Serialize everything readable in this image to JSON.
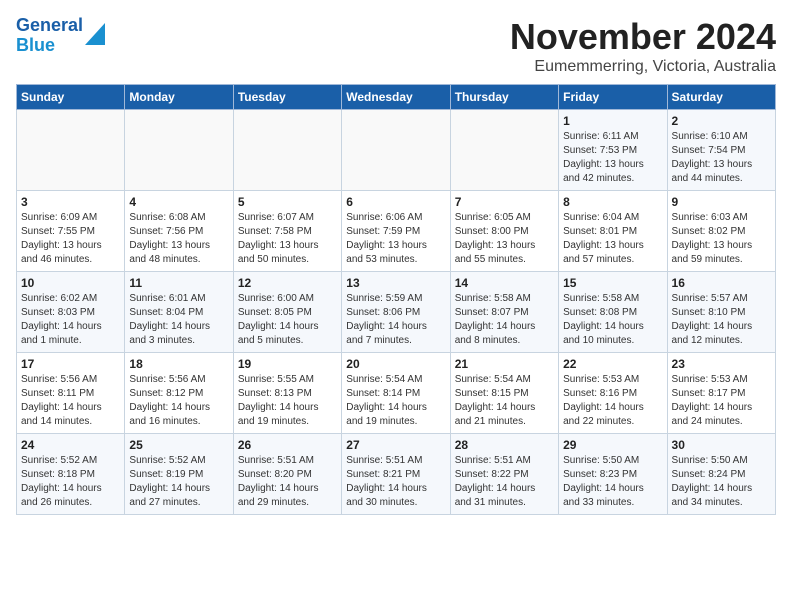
{
  "header": {
    "logo_line1": "General",
    "logo_line2": "Blue",
    "month": "November 2024",
    "location": "Eumemmerring, Victoria, Australia"
  },
  "weekdays": [
    "Sunday",
    "Monday",
    "Tuesday",
    "Wednesday",
    "Thursday",
    "Friday",
    "Saturday"
  ],
  "weeks": [
    [
      {
        "day": "",
        "info": ""
      },
      {
        "day": "",
        "info": ""
      },
      {
        "day": "",
        "info": ""
      },
      {
        "day": "",
        "info": ""
      },
      {
        "day": "",
        "info": ""
      },
      {
        "day": "1",
        "info": "Sunrise: 6:11 AM\nSunset: 7:53 PM\nDaylight: 13 hours\nand 42 minutes."
      },
      {
        "day": "2",
        "info": "Sunrise: 6:10 AM\nSunset: 7:54 PM\nDaylight: 13 hours\nand 44 minutes."
      }
    ],
    [
      {
        "day": "3",
        "info": "Sunrise: 6:09 AM\nSunset: 7:55 PM\nDaylight: 13 hours\nand 46 minutes."
      },
      {
        "day": "4",
        "info": "Sunrise: 6:08 AM\nSunset: 7:56 PM\nDaylight: 13 hours\nand 48 minutes."
      },
      {
        "day": "5",
        "info": "Sunrise: 6:07 AM\nSunset: 7:58 PM\nDaylight: 13 hours\nand 50 minutes."
      },
      {
        "day": "6",
        "info": "Sunrise: 6:06 AM\nSunset: 7:59 PM\nDaylight: 13 hours\nand 53 minutes."
      },
      {
        "day": "7",
        "info": "Sunrise: 6:05 AM\nSunset: 8:00 PM\nDaylight: 13 hours\nand 55 minutes."
      },
      {
        "day": "8",
        "info": "Sunrise: 6:04 AM\nSunset: 8:01 PM\nDaylight: 13 hours\nand 57 minutes."
      },
      {
        "day": "9",
        "info": "Sunrise: 6:03 AM\nSunset: 8:02 PM\nDaylight: 13 hours\nand 59 minutes."
      }
    ],
    [
      {
        "day": "10",
        "info": "Sunrise: 6:02 AM\nSunset: 8:03 PM\nDaylight: 14 hours\nand 1 minute."
      },
      {
        "day": "11",
        "info": "Sunrise: 6:01 AM\nSunset: 8:04 PM\nDaylight: 14 hours\nand 3 minutes."
      },
      {
        "day": "12",
        "info": "Sunrise: 6:00 AM\nSunset: 8:05 PM\nDaylight: 14 hours\nand 5 minutes."
      },
      {
        "day": "13",
        "info": "Sunrise: 5:59 AM\nSunset: 8:06 PM\nDaylight: 14 hours\nand 7 minutes."
      },
      {
        "day": "14",
        "info": "Sunrise: 5:58 AM\nSunset: 8:07 PM\nDaylight: 14 hours\nand 8 minutes."
      },
      {
        "day": "15",
        "info": "Sunrise: 5:58 AM\nSunset: 8:08 PM\nDaylight: 14 hours\nand 10 minutes."
      },
      {
        "day": "16",
        "info": "Sunrise: 5:57 AM\nSunset: 8:10 PM\nDaylight: 14 hours\nand 12 minutes."
      }
    ],
    [
      {
        "day": "17",
        "info": "Sunrise: 5:56 AM\nSunset: 8:11 PM\nDaylight: 14 hours\nand 14 minutes."
      },
      {
        "day": "18",
        "info": "Sunrise: 5:56 AM\nSunset: 8:12 PM\nDaylight: 14 hours\nand 16 minutes."
      },
      {
        "day": "19",
        "info": "Sunrise: 5:55 AM\nSunset: 8:13 PM\nDaylight: 14 hours\nand 19 minutes."
      },
      {
        "day": "20",
        "info": "Sunrise: 5:54 AM\nSunset: 8:14 PM\nDaylight: 14 hours\nand 19 minutes."
      },
      {
        "day": "21",
        "info": "Sunrise: 5:54 AM\nSunset: 8:15 PM\nDaylight: 14 hours\nand 21 minutes."
      },
      {
        "day": "22",
        "info": "Sunrise: 5:53 AM\nSunset: 8:16 PM\nDaylight: 14 hours\nand 22 minutes."
      },
      {
        "day": "23",
        "info": "Sunrise: 5:53 AM\nSunset: 8:17 PM\nDaylight: 14 hours\nand 24 minutes."
      }
    ],
    [
      {
        "day": "24",
        "info": "Sunrise: 5:52 AM\nSunset: 8:18 PM\nDaylight: 14 hours\nand 26 minutes."
      },
      {
        "day": "25",
        "info": "Sunrise: 5:52 AM\nSunset: 8:19 PM\nDaylight: 14 hours\nand 27 minutes."
      },
      {
        "day": "26",
        "info": "Sunrise: 5:51 AM\nSunset: 8:20 PM\nDaylight: 14 hours\nand 29 minutes."
      },
      {
        "day": "27",
        "info": "Sunrise: 5:51 AM\nSunset: 8:21 PM\nDaylight: 14 hours\nand 30 minutes."
      },
      {
        "day": "28",
        "info": "Sunrise: 5:51 AM\nSunset: 8:22 PM\nDaylight: 14 hours\nand 31 minutes."
      },
      {
        "day": "29",
        "info": "Sunrise: 5:50 AM\nSunset: 8:23 PM\nDaylight: 14 hours\nand 33 minutes."
      },
      {
        "day": "30",
        "info": "Sunrise: 5:50 AM\nSunset: 8:24 PM\nDaylight: 14 hours\nand 34 minutes."
      }
    ]
  ]
}
